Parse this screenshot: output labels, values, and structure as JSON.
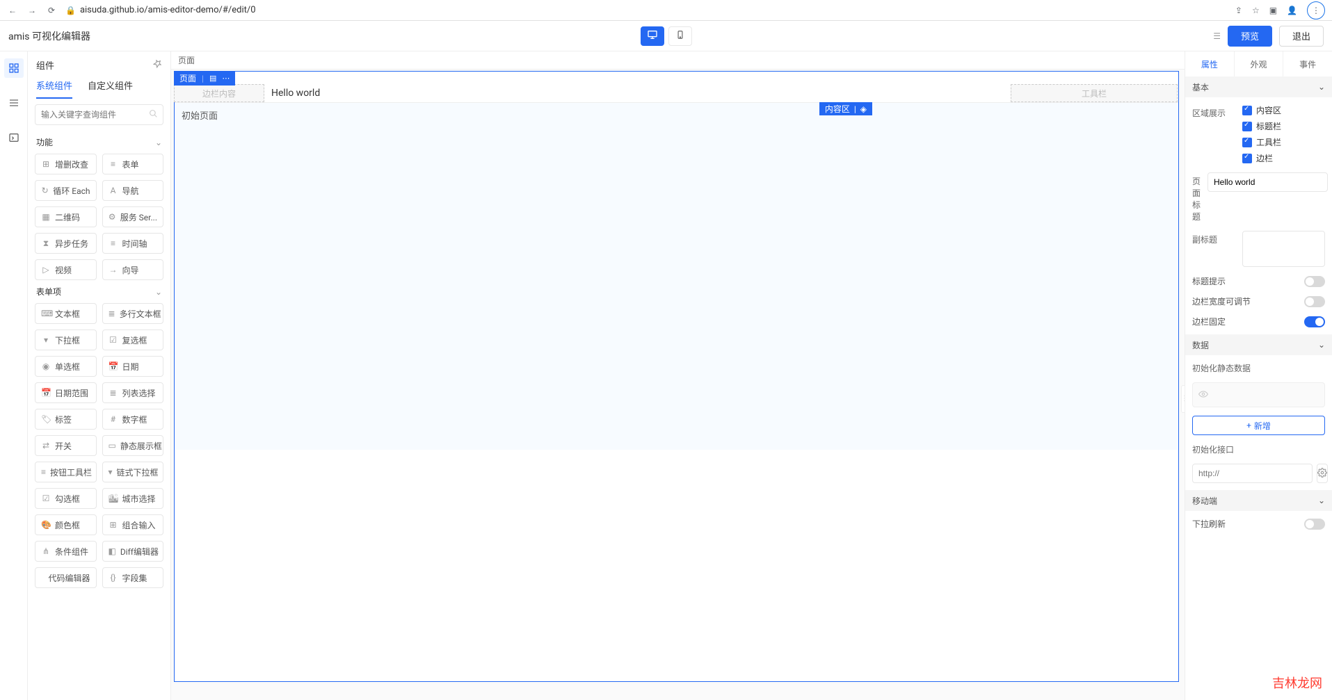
{
  "browser": {
    "url": "aisuda.github.io/amis-editor-demo/#/edit/0"
  },
  "app": {
    "title": "amis 可视化编辑器",
    "preview": "预览",
    "exit": "退出"
  },
  "leftPanel": {
    "title": "组件",
    "tabs": {
      "system": "系统组件",
      "custom": "自定义组件"
    },
    "searchPlaceholder": "输入关键字查询组件",
    "groups": [
      {
        "name": "功能",
        "items": [
          "增删改查",
          "表单",
          "循环 Each",
          "导航",
          "二维码",
          "服务 Ser...",
          "异步任务",
          "时间轴",
          "视频",
          "向导"
        ]
      },
      {
        "name": "表单项",
        "items": [
          "文本框",
          "多行文本框",
          "下拉框",
          "复选框",
          "单选框",
          "日期",
          "日期范围",
          "列表选择",
          "标签",
          "数字框",
          "开关",
          "静态展示框",
          "按钮工具栏",
          "链式下拉框",
          "勾选框",
          "城市选择",
          "颜色框",
          "组合输入",
          "条件组件",
          "Diff编辑器",
          "代码编辑器",
          "字段集"
        ]
      }
    ]
  },
  "canvas": {
    "crumb": "页面",
    "tag": "页面",
    "sideSlot": "边栏内容",
    "title": "Hello world",
    "toolSlot": "工具栏",
    "contentTag": "内容区",
    "contentText": "初始页面"
  },
  "rightPanel": {
    "tabs": {
      "attr": "属性",
      "appearance": "外观",
      "event": "事件"
    },
    "sections": {
      "basic": "基本",
      "data": "数据",
      "mobile": "移动端"
    },
    "labels": {
      "areaShow": "区域展示",
      "pageTitle": "页面标题",
      "subtitle": "副标题",
      "titleHint": "标题提示",
      "sideAdjustable": "边栏宽度可调节",
      "sideFixed": "边栏固定",
      "initStatic": "初始化静态数据",
      "add": "新增",
      "initApi": "初始化接口",
      "apiPlaceholder": "http://",
      "pullRefresh": "下拉刷新"
    },
    "checks": [
      "内容区",
      "标题栏",
      "工具栏",
      "边栏"
    ],
    "pageTitleValue": "Hello world"
  },
  "watermark": "吉林龙网"
}
